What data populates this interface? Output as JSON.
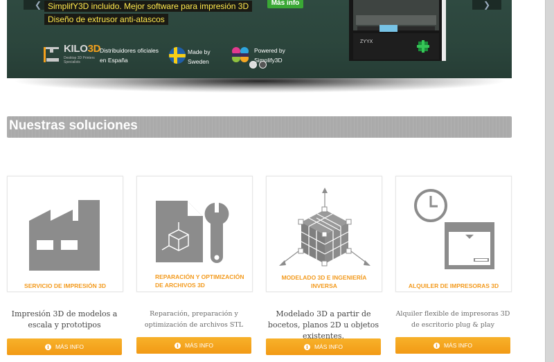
{
  "hero": {
    "arrow_left": "❮",
    "arrow_right": "❯",
    "features": [
      "SimplifY3D incluido. Mejor software para impresión 3D",
      "Diseño de extrusor anti-atascos"
    ],
    "cta_label": "Más info",
    "kilo_logo": {
      "brand_main": "KILO",
      "brand_accent": "3D",
      "tagline": "Desktop 3D Printers Specialists"
    },
    "distributors_line1": "Distribuidores oficiales",
    "distributors_line2": "en España",
    "made_by_line1": "Made by",
    "made_by_line2": "Sweden",
    "powered_line1": "Powered by",
    "powered_line2": "Simplify3D",
    "printer_brand": "ZYYX",
    "slide_dots": 2,
    "active_slide": 1
  },
  "section": {
    "title": "Nuestras soluciones"
  },
  "solutions": [
    {
      "icon": "factory-icon",
      "title": "SERVICIO DE IMPRESIÓN 3D",
      "description": "Impresión 3D de modelos a escala y prototipos",
      "button": "MÁS INFO"
    },
    {
      "icon": "file-wrench-icon",
      "title_line1": "REPARACIÓN Y OPTIMIZACIÓN",
      "title_line2": "DE ARCHIVOS 3D",
      "description": "Reparación, preparación y optimización de archivos STL",
      "button": "MÁS INFO"
    },
    {
      "icon": "cube-model-icon",
      "title": "MODELADO 3D E INGENIERÍA INVERSA",
      "description": "Modelado 3D a partir de bocetos, planos 2D u objetos existentes.",
      "button": "MÁS INFO"
    },
    {
      "icon": "clock-printer-icon",
      "title": "ALQUILER DE IMPRESORAS 3D",
      "description": "Alquiler flexible de impresoras 3D de escritorio plug & play",
      "button": "MÁS INFO"
    }
  ],
  "colors": {
    "accent": "#f39a1d",
    "hero_bg": "#2b453c",
    "icon_gray": "#8c8c8c",
    "cta_green": "#3aa835"
  }
}
